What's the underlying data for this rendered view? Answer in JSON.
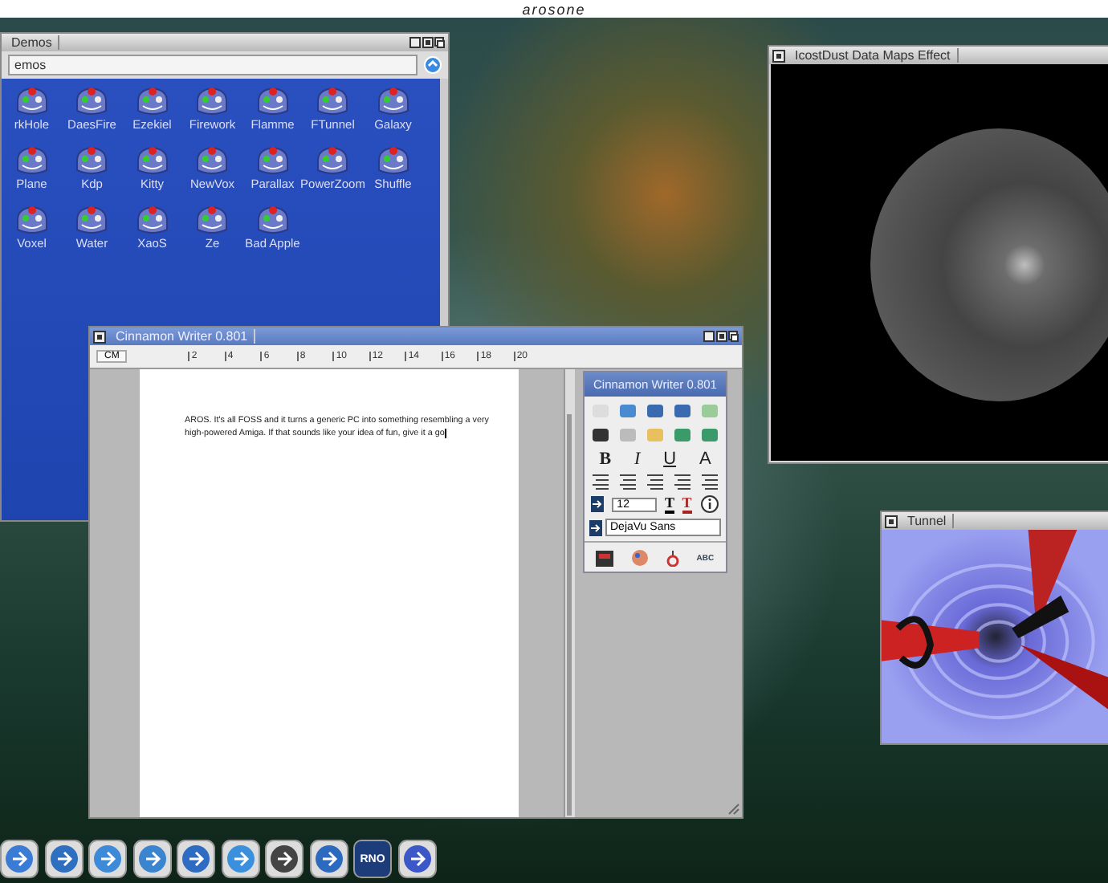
{
  "top_bar": {
    "logo": "arosone"
  },
  "demos_window": {
    "title": "Demos",
    "path": "emos",
    "icons": [
      {
        "label": "rkHole"
      },
      {
        "label": "DaesFire"
      },
      {
        "label": "Ezekiel"
      },
      {
        "label": "Firework"
      },
      {
        "label": "Flamme"
      },
      {
        "label": "FTunnel"
      },
      {
        "label": "Galaxy"
      },
      {
        "label": "Plane"
      },
      {
        "label": "Kdp"
      },
      {
        "label": "Kitty"
      },
      {
        "label": "NewVox"
      },
      {
        "label": "Parallax"
      },
      {
        "label": "PowerZoom"
      },
      {
        "label": "Shuffle"
      },
      {
        "label": "Voxel"
      },
      {
        "label": "Water"
      },
      {
        "label": "XaoS"
      },
      {
        "label": "Ze"
      },
      {
        "label": "Bad Apple"
      }
    ]
  },
  "effect_window": {
    "title": "IcostDust Data Maps Effect"
  },
  "writer_window": {
    "title": "Cinnamon Writer 0.801",
    "ruler_unit": "CM",
    "ruler_marks": [
      "2",
      "4",
      "6",
      "8",
      "10",
      "12",
      "14",
      "16",
      "18",
      "20"
    ],
    "document_text": "AROS. It's all FOSS and it turns a generic PC into something resembling a very high-powered Amiga. If that sounds like your idea of fun, give it a go"
  },
  "writer_panel": {
    "title": "Cinnamon Writer 0.801",
    "format_buttons": [
      "B",
      "I",
      "U",
      "A"
    ],
    "style_buttons": [
      "T",
      "T"
    ],
    "font_size": "12",
    "font_name": "DejaVu Sans",
    "spell_button": "ABC"
  },
  "tunnel_window": {
    "title": "Tunnel"
  },
  "dock": {
    "badge_label": "RNO"
  }
}
